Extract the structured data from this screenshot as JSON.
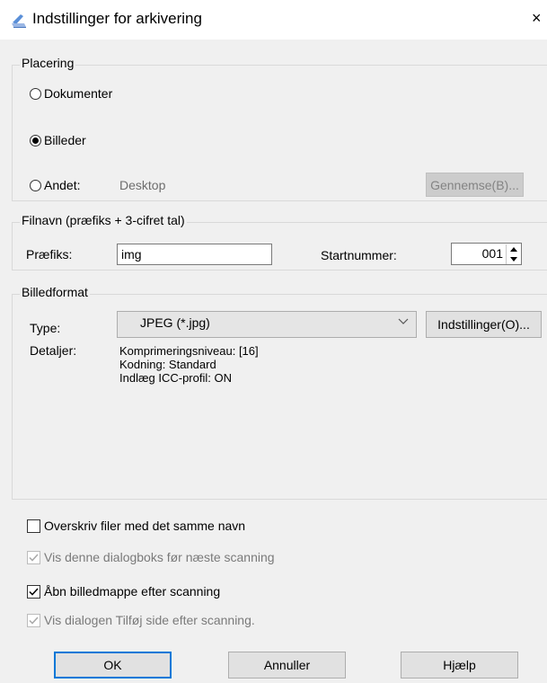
{
  "window": {
    "title": "Indstillinger for arkivering",
    "close_glyph": "×"
  },
  "placering": {
    "legend": "Placering",
    "options": [
      {
        "label": "Dokumenter",
        "checked": false
      },
      {
        "label": "Billeder",
        "checked": true
      },
      {
        "label": "Andet:",
        "checked": false
      }
    ],
    "other_path": "Desktop",
    "browse_label": "Gennemse(B)..."
  },
  "filnavn": {
    "legend": "Filnavn (præfiks + 3-cifret tal)",
    "prefix_label": "Præfiks:",
    "prefix_value": "img",
    "start_label": "Startnummer:",
    "start_value": "001"
  },
  "billedformat": {
    "legend": "Billedformat",
    "type_label": "Type:",
    "type_value": "JPEG (*.jpg)",
    "settings_label": "Indstillinger(O)...",
    "details_label": "Detaljer:",
    "details": [
      "Komprimeringsniveau: [16]",
      "Kodning: Standard",
      "Indlæg ICC-profil: ON"
    ]
  },
  "checkboxes": [
    {
      "label": "Overskriv filer med det samme navn",
      "checked": false,
      "enabled": true
    },
    {
      "label": "Vis denne dialogboks før næste scanning",
      "checked": true,
      "enabled": false
    },
    {
      "label": "Åbn billedmappe efter scanning",
      "checked": true,
      "enabled": true
    },
    {
      "label": "Vis dialogen Tilføj side efter scanning.",
      "checked": true,
      "enabled": false
    }
  ],
  "buttons": {
    "ok": "OK",
    "cancel": "Annuller",
    "help": "Hjælp"
  },
  "icons": {
    "app": "scanner-icon",
    "dropdown": "chevron-down-icon",
    "spin_up": "triangle-up-icon",
    "spin_down": "triangle-down-icon",
    "check": "checkmark-icon"
  },
  "colors": {
    "dialog_bg": "#f0f0f0",
    "focus_border": "#0078d7",
    "disabled_text": "#7a7a7a"
  }
}
